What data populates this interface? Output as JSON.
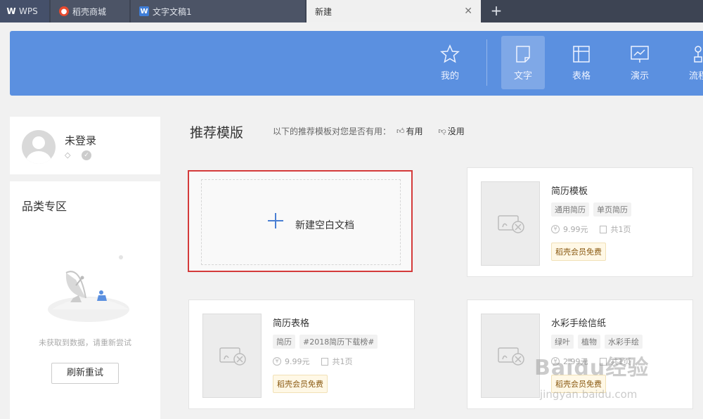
{
  "tabs": [
    {
      "label": "WPS",
      "icon": "wps-logo-icon"
    },
    {
      "label": "稻壳商城",
      "icon": "docer-flame-icon"
    },
    {
      "label": "文字文稿1",
      "icon": "word-doc-icon"
    },
    {
      "label": "新建",
      "icon": "close-icon",
      "active": true
    }
  ],
  "new_tab": "+",
  "nav": [
    {
      "label": "我的",
      "icon": "star-icon"
    },
    {
      "label": "文字",
      "icon": "document-icon",
      "active": true
    },
    {
      "label": "表格",
      "icon": "spreadsheet-icon"
    },
    {
      "label": "演示",
      "icon": "presentation-icon"
    },
    {
      "label": "流程",
      "icon": "flowchart-icon"
    }
  ],
  "user": {
    "name": "未登录"
  },
  "category": {
    "title": "品类专区",
    "empty_text": "未获取到数据，请重新尝试",
    "refresh_label": "刷新重试"
  },
  "main": {
    "title": "推荐模版",
    "feedback_prompt": "以下的推荐模板对您是否有用：",
    "useful": "有用",
    "useless": "没用",
    "new_blank": "新建空白文档"
  },
  "templates": [
    {
      "title": "简历模板",
      "tags": [
        "通用简历",
        "单页简历"
      ],
      "price": "9.99元",
      "pages": "共1页",
      "badge": "稻壳会员免费"
    },
    {
      "title": "简历表格",
      "tags": [
        "简历",
        "#2018简历下载榜#"
      ],
      "price": "9.99元",
      "pages": "共1页",
      "badge": "稻壳会员免费"
    },
    {
      "title": "水彩手绘信纸",
      "tags": [
        "绿叶",
        "植物",
        "水彩手绘"
      ],
      "price": "2.99元",
      "pages": "共1页",
      "badge": "稻壳会员免费"
    }
  ],
  "watermark": {
    "line1": "Baidu经验",
    "line2": "jingyan.baidu.com"
  },
  "colors": {
    "banner": "#5b90e0",
    "accent_red": "#d43a3a",
    "tabbar": "#3d4453"
  }
}
